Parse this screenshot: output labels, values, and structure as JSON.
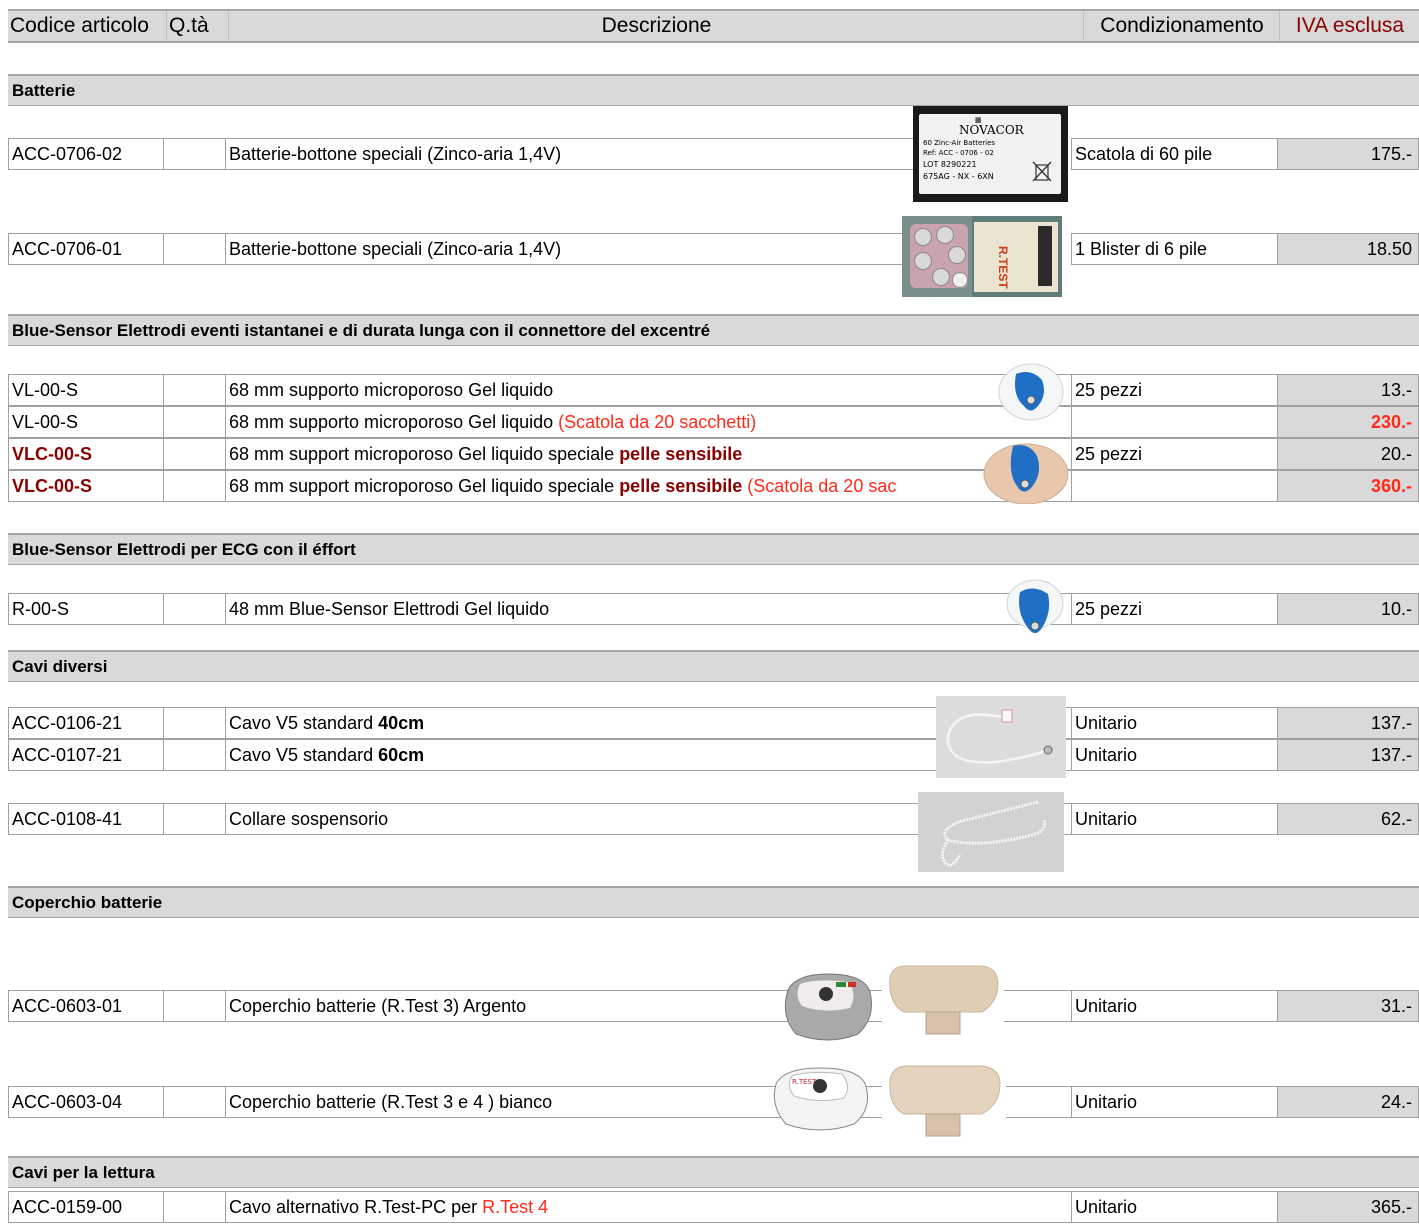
{
  "header": {
    "code": "Codice articolo",
    "qty": "Q.tà",
    "description": "Descrizione",
    "packaging": "Condizionamento",
    "vat": "IVA  esclusa"
  },
  "colors": {
    "vat_header": "#8b0000",
    "dark_red": "#8b0000",
    "red": "#ff2a1a",
    "section_bg": "#d9d9d9",
    "price_bg": "#d9d9d9"
  },
  "sections": {
    "batterie": "Batterie",
    "blue_istantanei": "Blue-Sensor Elettrodi eventi istantanei e di durata lunga con il connettore del excentré",
    "blue_ecg": "Blue-Sensor Elettrodi per ECG con il éffort",
    "cavi": "Cavi diversi",
    "coperchio": "Coperchio batterie",
    "cavi_lettura": "Cavi per la lettura"
  },
  "images": {
    "novacor_brand": "NOVACOR",
    "novacor_line1": "60 Zinc-Air Batteries",
    "novacor_line2": "Ref: ACC - 0706 - 02",
    "novacor_line3": "LOT 8290221",
    "novacor_line4": "675AG - NX - 6XN",
    "blister_brand": "R.TEST",
    "device_brand": "R.TEST"
  },
  "rows": {
    "r1": {
      "code": "ACC-0706-02",
      "desc": "Batterie-bottone speciali (Zinco-aria 1,4V)",
      "pack": "Scatola di 60 pile",
      "price": "175.-"
    },
    "r2": {
      "code": "ACC-0706-01",
      "desc": "Batterie-bottone speciali (Zinco-aria 1,4V)",
      "pack": "1 Blister di 6 pile",
      "price": "18.50"
    },
    "r3": {
      "code": "VL-00-S",
      "desc": "68 mm supporto microporoso Gel liquido",
      "pack": "25 pezzi",
      "price": "13.-"
    },
    "r4": {
      "code": "VL-00-S",
      "desc": "68 mm supporto microporoso Gel liquido ",
      "desc_red": "(Scatola da 20 sacchetti)",
      "pack": "",
      "price": "230.-"
    },
    "r5": {
      "code": "VLC-00-S",
      "desc": "68 mm support microporoso Gel liquido speciale ",
      "desc_bold": "pelle sensibile",
      "pack": "25 pezzi",
      "price": "20.-"
    },
    "r6": {
      "code": "VLC-00-S",
      "desc": "68 mm support microporoso Gel liquido speciale ",
      "desc_bold": "pelle sensibile",
      "desc_red": " (Scatola da 20 sac",
      "pack": "",
      "price": "360.-"
    },
    "r7": {
      "code": "R-00-S",
      "desc": "48 mm Blue-Sensor Elettrodi Gel liquido",
      "pack": "25 pezzi",
      "price": "10.-"
    },
    "r8": {
      "code": "ACC-0106-21",
      "desc": "Cavo V5 standard ",
      "desc_bold": "40cm",
      "pack": "Unitario",
      "price": "137.-"
    },
    "r9": {
      "code": "ACC-0107-21",
      "desc": "Cavo V5 standard ",
      "desc_bold": "60cm",
      "pack": "Unitario",
      "price": "137.-"
    },
    "r10": {
      "code": "ACC-0108-41",
      "desc": "Collare sospensorio",
      "pack": "Unitario",
      "price": "62.-"
    },
    "r11": {
      "code": "ACC-0603-01",
      "desc": "Coperchio batterie  (R.Test 3) Argento",
      "pack": "Unitario",
      "price": "31.-"
    },
    "r12": {
      "code": "ACC-0603-04",
      "desc": "Coperchio batterie  (R.Test 3 e 4 ) bianco",
      "pack": "Unitario",
      "price": "24.-"
    },
    "r13": {
      "code": "ACC-0159-00",
      "desc": "Cavo alternativo R.Test-PC per ",
      "desc_red": "R.Test 4",
      "pack": "Unitario",
      "price": "365.-"
    }
  }
}
